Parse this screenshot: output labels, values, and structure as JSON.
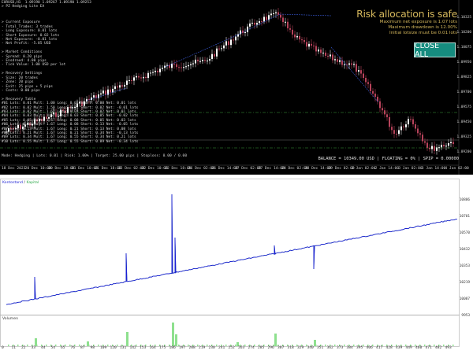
{
  "chart": {
    "symbol_line": "EURUSD,H1  1.09190 1.09267 1.09190 1.09253",
    "ea_name": "> PZ Hedging Lite EA",
    "info_lines": [
      "",
      "> Current Exposure",
      "- Total Trades: 3 trades",
      "- Long Exposure: 0.01 lots",
      "- Short Exposure: 0.02 lots",
      "- Net Exposure: -0.01 lots",
      "- Net Profit: -5.85 USD",
      "",
      "> Market Conditions",
      "- Spread: 0.20 pips",
      "- Ensdreed: 4.00 pips",
      "- Tick Value: 1.00 USD per lot",
      "",
      "> Recovery Settings",
      "- Size: 20 trades",
      "- Zone: 20 pips",
      "- Exit: 25 pips + 5 pips",
      "- Costs: 0.00 pips",
      "",
      "> Recovery Table",
      "#01 Lots: 0.01 Mult: 1.00 Long: 0.01 Short: 0.00 Net: 0.01 lots",
      "#02 Lots: 0.02 Mult: 1.50 Long: 0.01 Short: 0.02 Net: -0.01 lots",
      "#03 Lots: 0.02 Mult: 1.67 Long: 0.03 Short: 0.02 Net: 0.01 lots",
      "#04 Lots: 0.03 Mult: 1.67 Long: 0.03 Short: 0.05 Net: -0.02 lots",
      "#05 Lots: 0.05 Mult: 1.67 Long: 0.08 Short: 0.05 Net: 0.03 lots",
      "#06 Lots: 0.08 Mult: 1.67 Long: 0.08 Short: 0.13 Net: -0.05 lots",
      "#07 Lots: 0.13 Mult: 1.67 Long: 0.21 Short: 0.13 Net: 0.08 lots",
      "#08 Lots: 0.21 Mult: 1.67 Long: 0.21 Short: 0.34 Net: -0.13 lots",
      "#09 Lots: 0.34 Mult: 1.67 Long: 0.55 Short: 0.34 Net: 0.21 lots",
      "#10 Lots: 0.55 Mult: 1.67 Long: 0.55 Short: 0.89 Net: -0.34 lots"
    ],
    "status_bottom": "Mode: Hedging | Lots: 0.01 | Risk: 1.00% | Target: 25.00 pips | Stoploss: 0.00 / 0.00",
    "risk_title": "Risk allocation is safe",
    "risk_lines": [
      "Maximum net exposure is 1.07 lots",
      "Maximum drawdown is 12.00%",
      "Initial lotsize must be 0.01 lots"
    ],
    "close_button": "CLOSE ALL",
    "balance_line": "BALANCE = 10349.00 USD  |  FLOATING = 0%  |  SPIP = 0.00000",
    "x_labels": [
      "18 Dec 2023",
      "20 Dec 10:00",
      "20 Dec 18:00",
      "21 Dec 10:00",
      "21 Dec 18:00",
      "22 Dec 02:00",
      "22 Dec 10:00",
      "22 Dec 18:00",
      "26 Dec 02:00",
      "26 Dec 14:00",
      "27 Dec 02:00",
      "27 Dec 14:00",
      "28 Dec 02:00",
      "28 Dec 14:00",
      "29 Dec 02:00",
      "2 Jan 02:00",
      "2 Jan 14:00",
      "3 Jan 02:00",
      "3 Jan 14:00",
      "4 Jan 02:00"
    ],
    "y_labels": [
      "1.10325",
      "1.10200",
      "1.10075",
      "1.09950",
      "1.09825",
      "1.09700",
      "1.09575",
      "1.09450",
      "1.09325",
      "1.09200"
    ],
    "colors": {
      "bull": "#ffffff",
      "bear": "#b8435b",
      "bg": "#000000"
    }
  },
  "equity": {
    "legend_balance": "Kontostand",
    "legend_sep": " / ",
    "legend_equity": "Kapital",
    "y_labels": [
      "10806",
      "10701",
      "10570",
      "10432",
      "10353",
      "10219",
      "10087",
      "9953"
    ],
    "volume_label": "Volumen",
    "x_labels": [
      "0",
      "11",
      "22",
      "33",
      "44",
      "54",
      "65",
      "76",
      "87",
      "98",
      "109",
      "120",
      "131",
      "142",
      "153",
      "164",
      "175",
      "186",
      "197",
      "208",
      "219",
      "230",
      "241",
      "252",
      "263",
      "274",
      "285",
      "296",
      "307",
      "318",
      "329",
      "340",
      "351",
      "362",
      "373",
      "384",
      "395",
      "406",
      "417",
      "428",
      "439",
      "449",
      "460",
      "471",
      "482",
      "493"
    ],
    "colors": {
      "balance": "#1a1fd4",
      "equity": "#2ea84a",
      "volume": "#8ee08e"
    }
  }
}
